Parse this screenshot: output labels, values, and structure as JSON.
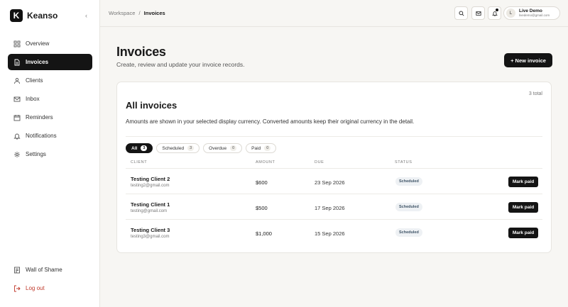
{
  "brand": {
    "logo_letter": "K",
    "name": "Keanso",
    "collapse_glyph": "‹"
  },
  "nav": {
    "items": [
      {
        "label": "Overview",
        "icon": "grid-icon"
      },
      {
        "label": "Invoices",
        "icon": "document-icon",
        "active": true
      },
      {
        "label": "Clients",
        "icon": "user-icon"
      },
      {
        "label": "Inbox",
        "icon": "mail-icon"
      },
      {
        "label": "Reminders",
        "icon": "calendar-icon"
      },
      {
        "label": "Notifications",
        "icon": "bell-icon"
      },
      {
        "label": "Settings",
        "icon": "gear-icon"
      }
    ],
    "bottom": [
      {
        "label": "Wall of Shame",
        "icon": "list-icon"
      },
      {
        "label": "Log out",
        "icon": "logout-icon"
      }
    ]
  },
  "topbar": {
    "breadcrumb_root": "Workspace",
    "breadcrumb_sep": "/",
    "breadcrumb_current": "Invoices",
    "user_initial": "L",
    "user_name": "Live Demo",
    "user_email": "livedemo@gmail.com"
  },
  "page": {
    "title": "Invoices",
    "subtitle": "Create, review and update your invoice records.",
    "new_button": "+ New invoice"
  },
  "card": {
    "total": "3 total",
    "title": "All invoices",
    "description": "Amounts are shown in your selected display currency. Converted amounts keep their original currency in the detail."
  },
  "filters": [
    {
      "label": "All",
      "count": "3",
      "active": true
    },
    {
      "label": "Scheduled",
      "count": "3"
    },
    {
      "label": "Overdue",
      "count": "0"
    },
    {
      "label": "Paid",
      "count": "0"
    }
  ],
  "table": {
    "columns": {
      "client": "CLIENT",
      "amount": "AMOUNT",
      "due": "DUE",
      "status": "STATUS"
    },
    "rows": [
      {
        "name": "Testing Client 2",
        "email": "testing2@gmail.com",
        "amount": "$600",
        "due": "23 Sep 2026",
        "status": "Scheduled",
        "action": "Mark paid"
      },
      {
        "name": "Testing Client 1",
        "email": "testing@gmail.com",
        "amount": "$500",
        "due": "17 Sep 2026",
        "status": "Scheduled",
        "action": "Mark paid"
      },
      {
        "name": "Testing Client 3",
        "email": "testing3@gmail.com",
        "amount": "$1,000",
        "due": "15 Sep 2026",
        "status": "Scheduled",
        "action": "Mark paid"
      }
    ]
  },
  "colors": {
    "primary": "#141414",
    "background": "#f7f6f3",
    "danger": "#c0392b",
    "badge_bg": "#eef1f4",
    "badge_text": "#3e5366"
  }
}
